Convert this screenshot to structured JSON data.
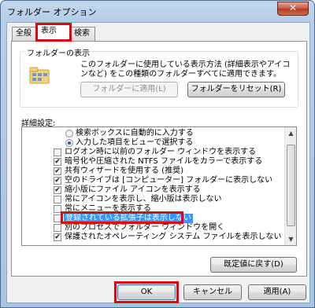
{
  "window": {
    "title": "フォルダー オプション",
    "close_glyph": "✕"
  },
  "tabs": [
    {
      "label": "全般"
    },
    {
      "label": "表示"
    },
    {
      "label": "検索"
    }
  ],
  "folder_view": {
    "group_label": "フォルダーの表示",
    "description": "このフォルダーに使用している表示方法 (詳細表示やアイコンなど) をこの種類のフォルダーすべてに適用できます。",
    "apply_button": "フォルダーに適用(L)",
    "reset_button": "フォルダーをリセット(R)"
  },
  "advanced": {
    "label": "詳細設定:",
    "items": [
      {
        "type": "radio",
        "checked": false,
        "label": "検索ボックスに自動的に入力する"
      },
      {
        "type": "radio",
        "checked": true,
        "label": "入力した項目をビューで選択する"
      },
      {
        "type": "checkbox",
        "checked": false,
        "label": "ログオン時に以前のフォルダー ウィンドウを表示する"
      },
      {
        "type": "checkbox",
        "checked": true,
        "label": "暗号化や圧縮された NTFS ファイルをカラーで表示する"
      },
      {
        "type": "checkbox",
        "checked": true,
        "label": "共有ウィザードを使用する (推奨)"
      },
      {
        "type": "checkbox",
        "checked": true,
        "label": "空のドライブは [コンピューター] フォルダーに表示しない"
      },
      {
        "type": "checkbox",
        "checked": true,
        "label": "縮小版にファイル アイコンを表示する"
      },
      {
        "type": "checkbox",
        "checked": false,
        "label": "常にアイコンを表示し、縮小版は表示しない"
      },
      {
        "type": "checkbox",
        "checked": false,
        "label": "常にメニューを表示する"
      },
      {
        "type": "checkbox",
        "checked": false,
        "label": "登録されている拡張子は表示しない"
      },
      {
        "type": "checkbox",
        "checked": false,
        "label": "別のプロセスでフォルダー ウィンドウを開く"
      },
      {
        "type": "checkbox",
        "checked": true,
        "label": "保護されたオペレーティング システム ファイルを表示しない (推奨)"
      }
    ],
    "check_glyph": "✔"
  },
  "restore_button": "既定値に戻す(D)",
  "footer": {
    "ok": "OK",
    "cancel": "キャンセル",
    "apply": "適用(A)"
  },
  "colors": {
    "highlight_box": "#e8000b",
    "selection": "#3399ff"
  }
}
